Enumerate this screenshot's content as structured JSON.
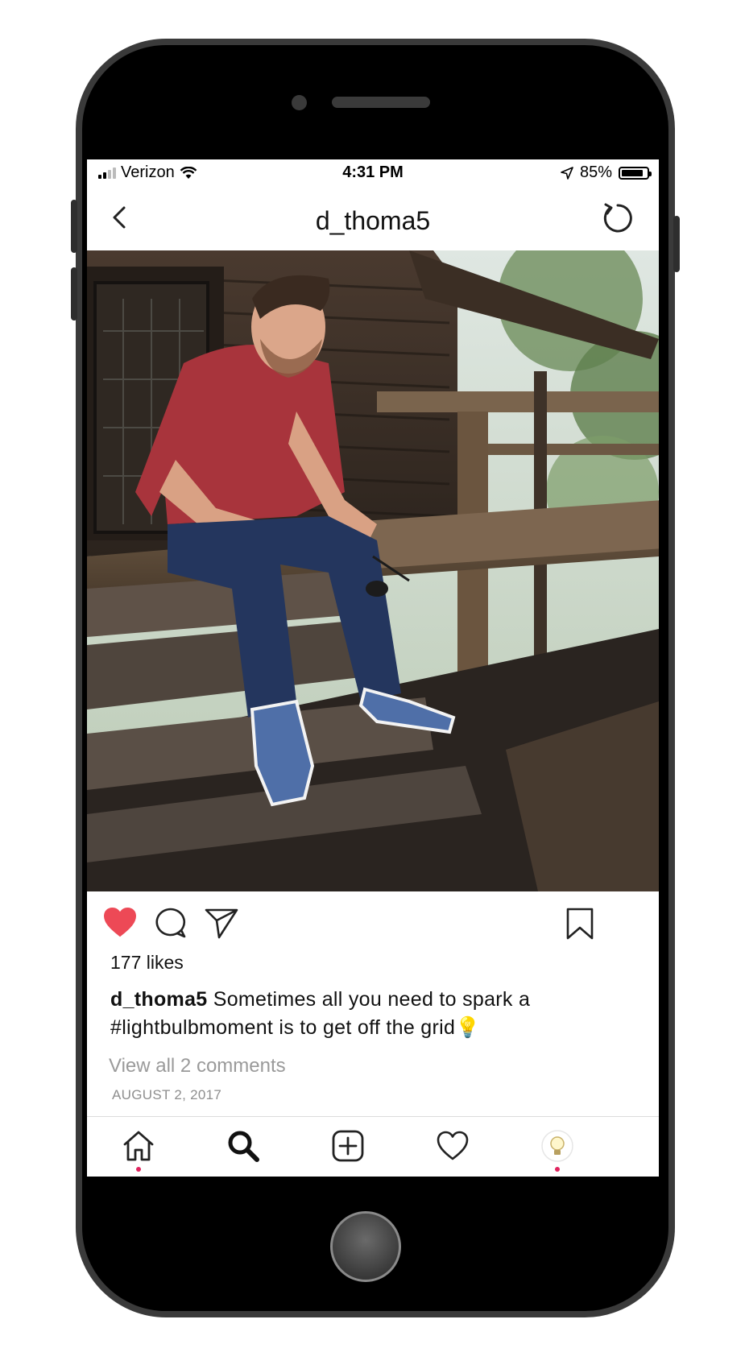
{
  "status_bar": {
    "carrier": "Verizon",
    "time": "4:31 PM",
    "battery": "85%",
    "battery_level": 0.85,
    "icons": [
      "signal-icon",
      "wifi-icon",
      "location-arrow-icon",
      "battery-icon"
    ]
  },
  "header": {
    "username": "d_thoma5",
    "back_icon": "chevron-left-icon",
    "refresh_icon": "refresh-icon"
  },
  "post": {
    "liked": true,
    "likes_text": "177 likes",
    "caption_user": "d_thoma5",
    "caption_line1": "Sometimes all you need to spark a",
    "caption_line2": "#lightbulbmoment is to get off the grid",
    "caption_emoji": "💡",
    "comments_link": "View all 2 comments",
    "date": "AUGUST 2, 2017",
    "action_icons": [
      "heart-icon",
      "comment-icon",
      "share-icon",
      "bookmark-icon"
    ]
  },
  "tab_bar": {
    "items": [
      "home-icon",
      "search-icon",
      "add-post-icon",
      "activity-heart-icon",
      "profile-avatar"
    ]
  },
  "colors": {
    "like_red": "#ed4956",
    "notification_dot": "#e0245e",
    "muted_text": "#9a9a9a"
  }
}
